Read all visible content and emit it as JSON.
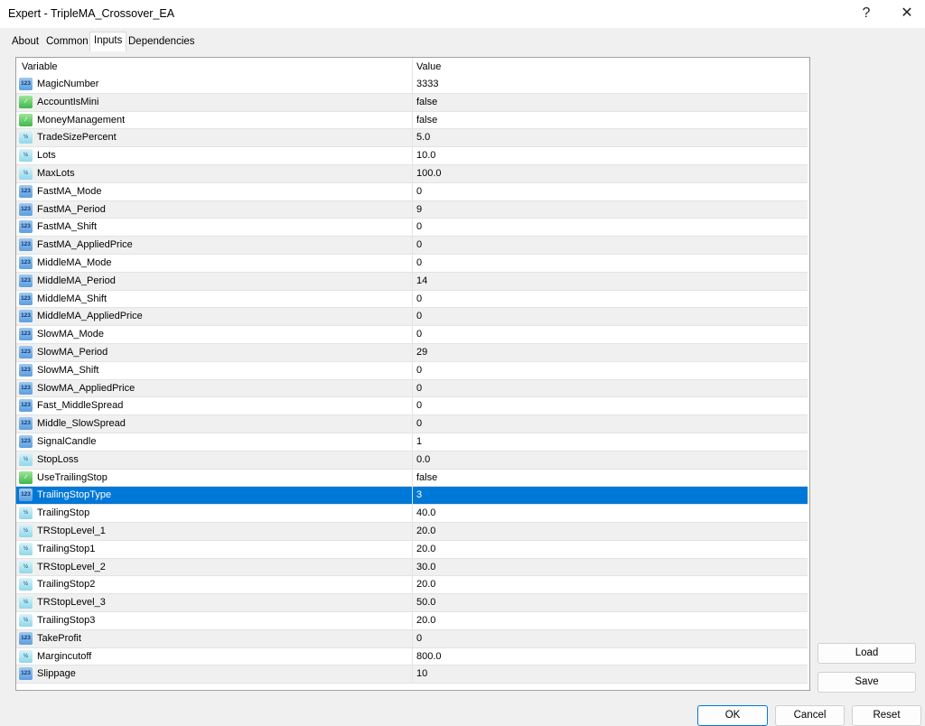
{
  "window": {
    "title": "Expert - TripleMA_Crossover_EA",
    "help_label": "?",
    "close_label": "✕"
  },
  "tabs": [
    {
      "label": "About",
      "active": false
    },
    {
      "label": "Common",
      "active": false
    },
    {
      "label": "Inputs",
      "active": true
    },
    {
      "label": "Dependencies",
      "active": false
    }
  ],
  "grid": {
    "columns": {
      "variable": "Variable",
      "value": "Value"
    },
    "selected_index": 23,
    "icon_types": {
      "int": "integer-123-icon",
      "bool": "boolean-chart-icon",
      "dbl": "double-half-icon"
    },
    "icon_text": {
      "int": "123",
      "bool": "⁄",
      "dbl": "½"
    },
    "rows": [
      {
        "name": "MagicNumber",
        "value": "3333",
        "type": "int"
      },
      {
        "name": "AccountIsMini",
        "value": "false",
        "type": "bool"
      },
      {
        "name": "MoneyManagement",
        "value": "false",
        "type": "bool"
      },
      {
        "name": "TradeSizePercent",
        "value": "5.0",
        "type": "dbl"
      },
      {
        "name": "Lots",
        "value": "10.0",
        "type": "dbl"
      },
      {
        "name": "MaxLots",
        "value": "100.0",
        "type": "dbl"
      },
      {
        "name": "FastMA_Mode",
        "value": "0",
        "type": "int"
      },
      {
        "name": "FastMA_Period",
        "value": "9",
        "type": "int"
      },
      {
        "name": "FastMA_Shift",
        "value": "0",
        "type": "int"
      },
      {
        "name": "FastMA_AppliedPrice",
        "value": "0",
        "type": "int"
      },
      {
        "name": "MiddleMA_Mode",
        "value": "0",
        "type": "int"
      },
      {
        "name": "MiddleMA_Period",
        "value": "14",
        "type": "int"
      },
      {
        "name": "MiddleMA_Shift",
        "value": "0",
        "type": "int"
      },
      {
        "name": "MiddleMA_AppliedPrice",
        "value": "0",
        "type": "int"
      },
      {
        "name": "SlowMA_Mode",
        "value": "0",
        "type": "int"
      },
      {
        "name": "SlowMA_Period",
        "value": "29",
        "type": "int"
      },
      {
        "name": "SlowMA_Shift",
        "value": "0",
        "type": "int"
      },
      {
        "name": "SlowMA_AppliedPrice",
        "value": "0",
        "type": "int"
      },
      {
        "name": "Fast_MiddleSpread",
        "value": "0",
        "type": "int"
      },
      {
        "name": "Middle_SlowSpread",
        "value": "0",
        "type": "int"
      },
      {
        "name": "SignalCandle",
        "value": "1",
        "type": "int"
      },
      {
        "name": "StopLoss",
        "value": "0.0",
        "type": "dbl"
      },
      {
        "name": "UseTrailingStop",
        "value": "false",
        "type": "bool"
      },
      {
        "name": "TrailingStopType",
        "value": "3",
        "type": "int"
      },
      {
        "name": "TrailingStop",
        "value": "40.0",
        "type": "dbl"
      },
      {
        "name": "TRStopLevel_1",
        "value": "20.0",
        "type": "dbl"
      },
      {
        "name": "TrailingStop1",
        "value": "20.0",
        "type": "dbl"
      },
      {
        "name": "TRStopLevel_2",
        "value": "30.0",
        "type": "dbl"
      },
      {
        "name": "TrailingStop2",
        "value": "20.0",
        "type": "dbl"
      },
      {
        "name": "TRStopLevel_3",
        "value": "50.0",
        "type": "dbl"
      },
      {
        "name": "TrailingStop3",
        "value": "20.0",
        "type": "dbl"
      },
      {
        "name": "TakeProfit",
        "value": "0",
        "type": "int"
      },
      {
        "name": "Margincutoff",
        "value": "800.0",
        "type": "dbl"
      },
      {
        "name": "Slippage",
        "value": "10",
        "type": "int"
      }
    ]
  },
  "buttons": {
    "load": "Load",
    "save": "Save",
    "ok": "OK",
    "cancel": "Cancel",
    "reset": "Reset"
  },
  "colors": {
    "selection": "#0078d7",
    "alt_row": "#f0f0f0"
  }
}
